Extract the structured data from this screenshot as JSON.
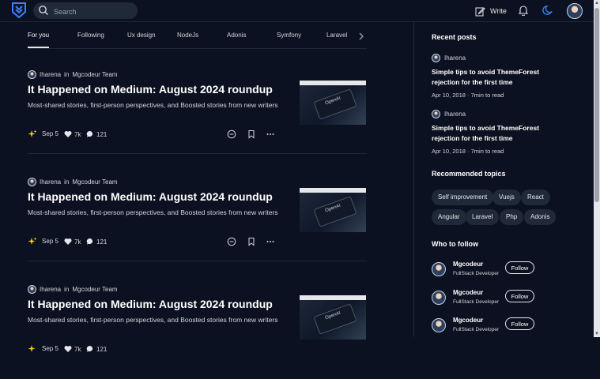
{
  "header": {
    "logo_icon": "shield-chevron-logo",
    "search_placeholder": "Search",
    "write_label": "Write",
    "icons": [
      "write-icon",
      "bell-icon",
      "moon-icon"
    ]
  },
  "tabs": {
    "items": [
      {
        "label": "For you",
        "active": true
      },
      {
        "label": "Following"
      },
      {
        "label": "Ux design"
      },
      {
        "label": "NodeJs"
      },
      {
        "label": "Adonis"
      },
      {
        "label": "Symfony"
      },
      {
        "label": "Laravel"
      }
    ]
  },
  "articles": [
    {
      "author": "Iharena",
      "in_word": "in",
      "publication": "Mgcodeur Team",
      "title": "It Happened on Medium: August 2024 roundup",
      "subtitle": "Most-shared stories, first-person perspectives, and Boosted stories from new writers",
      "date": "Sep 5",
      "claps": "7k",
      "comments": "121",
      "thumb_text": "OpenAI"
    },
    {
      "author": "Iharena",
      "in_word": "in",
      "publication": "Mgcodeur Team",
      "title": "It Happened on Medium: August 2024 roundup",
      "subtitle": "Most-shared stories, first-person perspectives, and Boosted stories from new writers",
      "date": "Sep 5",
      "claps": "7k",
      "comments": "121",
      "thumb_text": "OpenAI"
    },
    {
      "author": "Iharena",
      "in_word": "in",
      "publication": "Mgcodeur Team",
      "title": "It Happened on Medium: August 2024 roundup",
      "subtitle": "Most-shared stories, first-person perspectives, and Boosted stories from new writers",
      "date": "Sep 5",
      "claps": "7k",
      "comments": "121",
      "thumb_text": "OpenAI"
    }
  ],
  "sidebar": {
    "recent_heading": "Recent posts",
    "recent_posts": [
      {
        "author": "Iharena",
        "title": "Simple tips to avoid ThemeForest rejection for the first time",
        "date": "Apr 10, 2018",
        "read_time": "7min to read"
      },
      {
        "author": "Iharena",
        "title": "Simple tips to avoid ThemeForest rejection for the first time",
        "date": "Apr 10, 2018",
        "read_time": "7min to read"
      }
    ],
    "topics_heading": "Recommended topics",
    "topics": [
      "Self improvement",
      "Vuejs",
      "React",
      "Angular",
      "Laravel",
      "Php",
      "Adonis"
    ],
    "follow_heading": "Who to follow",
    "follow": [
      {
        "name": "Mgcodeur",
        "role": "FullStack Developer",
        "button": "Follow"
      },
      {
        "name": "Mgcodeur",
        "role": "FullStack Developer",
        "button": "Follow"
      },
      {
        "name": "Mgcodeur",
        "role": "FullStack Developer",
        "button": "Follow"
      }
    ]
  },
  "colors": {
    "background": "#0b1120",
    "accent": "#3b82f6",
    "sparkle": "#facc15",
    "chip": "#1f2937"
  }
}
